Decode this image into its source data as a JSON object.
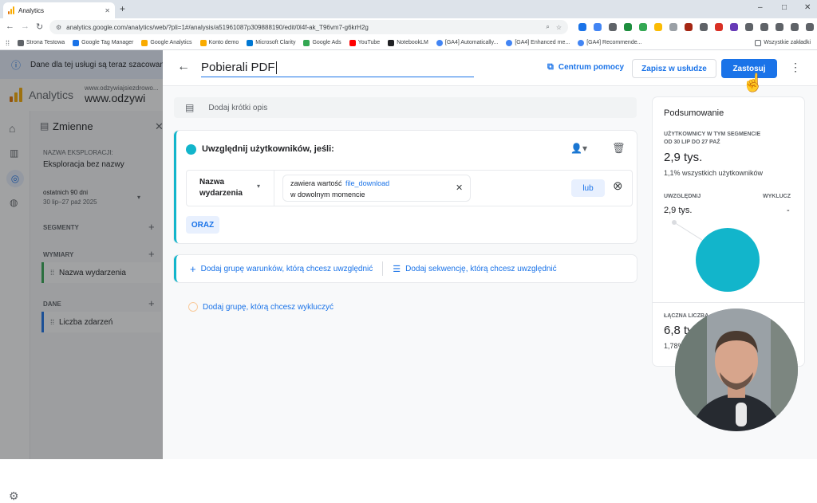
{
  "browser": {
    "tab_title": "Analytics",
    "new_tab": "+",
    "url": "analytics.google.com/analytics/web/?pli=1#/analysis/a51961087p309888190/edit/0l4f-ak_T96vm7-g6krH2g",
    "window_controls": [
      "–",
      "□",
      "✕"
    ],
    "bookmarks": [
      {
        "label": "Strona Testowa",
        "color": "#5f6368"
      },
      {
        "label": "Google Tag Manager",
        "color": "#1a73e8"
      },
      {
        "label": "Google Analytics",
        "color": "#f9ab00"
      },
      {
        "label": "Konto demo",
        "color": "#f9ab00"
      },
      {
        "label": "Microsoft Clarity",
        "color": "#0078d4"
      },
      {
        "label": "Google Ads",
        "color": "#34a853"
      },
      {
        "label": "YouTube",
        "color": "#ff0000"
      },
      {
        "label": "NotebookLM",
        "color": "#202124"
      },
      {
        "label": "[GA4] Automatically...",
        "color": "#4285f4"
      },
      {
        "label": "[GA4] Enhanced me...",
        "color": "#4285f4"
      },
      {
        "label": "[GA4] Recommende...",
        "color": "#4285f4"
      }
    ],
    "all_bookmarks": "Wszystkie zakładki"
  },
  "app": {
    "banner": "Dane dla tej usługi są teraz szacowan",
    "product": "Analytics",
    "site_small": "www.odzywiajsiezdrowo...",
    "site_large": "www.odzywi",
    "variables_title": "Zmienne",
    "exploration_label": "NAZWA EKSPLORACJI:",
    "exploration_name": "Eksploracja bez nazwy",
    "date_label": "ostatnich 90 dni",
    "date_range": "30 lip–27 paź 2025",
    "segments": "SEGMENTY",
    "dimensions": "WYMIARY",
    "dimension_item": "Nazwa wydarzenia",
    "metrics": "DANE",
    "metric_item": "Liczba zdarzeń"
  },
  "panel": {
    "title": "Pobierali PDF",
    "help": "Centrum pomocy",
    "save": "Zapisz w usłudze",
    "apply": "Zastosuj",
    "description_placeholder": "Dodaj krótki opis",
    "include_title": "Uwzględnij użytkowników, jeśli:",
    "condition_dimension_line1": "Nazwa",
    "condition_dimension_line2": "wydarzenia",
    "condition_operator": "zawiera wartość",
    "condition_value": "file_download",
    "condition_time": "w dowolnym momencie",
    "or_button": "lub",
    "and_button": "ORAZ",
    "add_include_group": "Dodaj grupę warunków, którą chcesz uwzględnić",
    "add_sequence": "Dodaj sekwencję, którą chcesz uwzględnić",
    "add_exclude_group": "Dodaj grupę, którą chcesz wykluczyć"
  },
  "summary": {
    "title": "Podsumowanie",
    "users_label_1": "UŻYTKOWNICY W TYM SEGMENCIE",
    "users_label_2": "OD 30 LIP DO 27 PAŹ",
    "users_value": "2,9 tys.",
    "users_share": "1,1% wszystkich użytkowników",
    "include_label": "UWZGLĘDNIJ",
    "exclude_label": "WYKLUCZ",
    "include_value": "2,9 tys.",
    "exclude_value": "-",
    "total_label": "ŁĄCZNA LICZBA",
    "total_value": "6,8 tys.",
    "total_share": "1,78%",
    "chart_color": "#12b5cb"
  },
  "colors": {
    "accent": "#1a73e8",
    "teal": "#12b5cb",
    "apply_bg": "#1a73e8"
  }
}
